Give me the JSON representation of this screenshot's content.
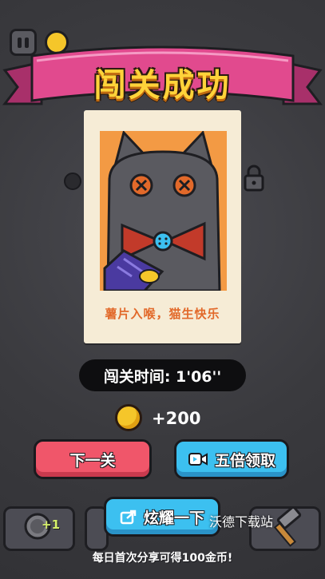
{
  "banner": {
    "title": "闯关成功"
  },
  "card": {
    "caption": "薯片入喉，猫生快乐"
  },
  "result": {
    "time_label": "闯关时间: 1'06''",
    "reward_amount": "+200"
  },
  "buttons": {
    "next_level": "下一关",
    "five_times": "五倍领取",
    "share": "炫耀一下"
  },
  "toolbar": {
    "badge": "+1"
  },
  "watermark": "沃德下载站",
  "share_tip": "每日首次分享可得100金币!",
  "colors": {
    "banner_pink": "#e14a8e",
    "title_yellow": "#ffd33a",
    "next_button": "#f0566a",
    "blue_button": "#3cc0f0",
    "card_art_bg": "#f39a44",
    "caption": "#e2692a"
  },
  "icons": {
    "pause": "pause-icon",
    "lock": "lock-icon",
    "video": "video-icon",
    "share": "share-icon",
    "coin": "coin-icon"
  }
}
